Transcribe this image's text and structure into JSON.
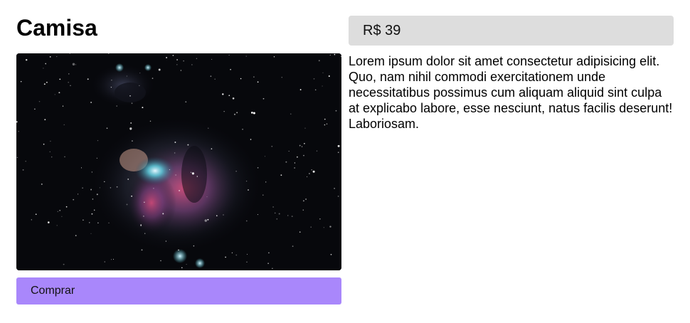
{
  "product": {
    "title": "Camisa",
    "price": "R$ 39",
    "description": "Lorem ipsum dolor sit amet consectetur adipisicing elit. Quo, nam nihil commodi exercitationem unde necessitatibus possimus cum aliquam aliquid sint culpa at explicabo labore, esse nesciunt, natus facilis deserunt! Laboriosam.",
    "buy_label": "Comprar"
  },
  "colors": {
    "buy_button": "#a987fb",
    "price_box": "#dddddd"
  }
}
